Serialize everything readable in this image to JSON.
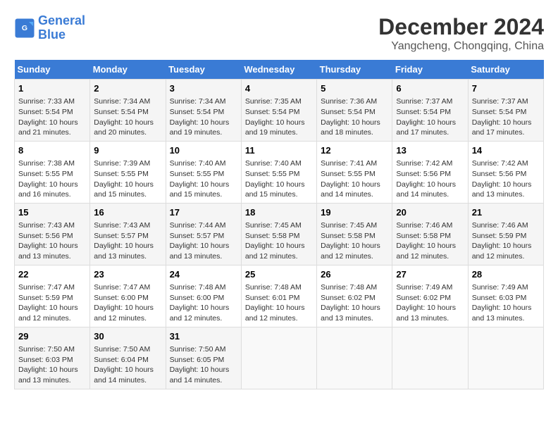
{
  "logo": {
    "line1": "General",
    "line2": "Blue"
  },
  "title": "December 2024",
  "location": "Yangcheng, Chongqing, China",
  "days_header": [
    "Sunday",
    "Monday",
    "Tuesday",
    "Wednesday",
    "Thursday",
    "Friday",
    "Saturday"
  ],
  "weeks": [
    [
      {
        "day": "1",
        "info": "Sunrise: 7:33 AM\nSunset: 5:54 PM\nDaylight: 10 hours\nand 21 minutes."
      },
      {
        "day": "2",
        "info": "Sunrise: 7:34 AM\nSunset: 5:54 PM\nDaylight: 10 hours\nand 20 minutes."
      },
      {
        "day": "3",
        "info": "Sunrise: 7:34 AM\nSunset: 5:54 PM\nDaylight: 10 hours\nand 19 minutes."
      },
      {
        "day": "4",
        "info": "Sunrise: 7:35 AM\nSunset: 5:54 PM\nDaylight: 10 hours\nand 19 minutes."
      },
      {
        "day": "5",
        "info": "Sunrise: 7:36 AM\nSunset: 5:54 PM\nDaylight: 10 hours\nand 18 minutes."
      },
      {
        "day": "6",
        "info": "Sunrise: 7:37 AM\nSunset: 5:54 PM\nDaylight: 10 hours\nand 17 minutes."
      },
      {
        "day": "7",
        "info": "Sunrise: 7:37 AM\nSunset: 5:54 PM\nDaylight: 10 hours\nand 17 minutes."
      }
    ],
    [
      {
        "day": "8",
        "info": "Sunrise: 7:38 AM\nSunset: 5:55 PM\nDaylight: 10 hours\nand 16 minutes."
      },
      {
        "day": "9",
        "info": "Sunrise: 7:39 AM\nSunset: 5:55 PM\nDaylight: 10 hours\nand 15 minutes."
      },
      {
        "day": "10",
        "info": "Sunrise: 7:40 AM\nSunset: 5:55 PM\nDaylight: 10 hours\nand 15 minutes."
      },
      {
        "day": "11",
        "info": "Sunrise: 7:40 AM\nSunset: 5:55 PM\nDaylight: 10 hours\nand 15 minutes."
      },
      {
        "day": "12",
        "info": "Sunrise: 7:41 AM\nSunset: 5:55 PM\nDaylight: 10 hours\nand 14 minutes."
      },
      {
        "day": "13",
        "info": "Sunrise: 7:42 AM\nSunset: 5:56 PM\nDaylight: 10 hours\nand 14 minutes."
      },
      {
        "day": "14",
        "info": "Sunrise: 7:42 AM\nSunset: 5:56 PM\nDaylight: 10 hours\nand 13 minutes."
      }
    ],
    [
      {
        "day": "15",
        "info": "Sunrise: 7:43 AM\nSunset: 5:56 PM\nDaylight: 10 hours\nand 13 minutes."
      },
      {
        "day": "16",
        "info": "Sunrise: 7:43 AM\nSunset: 5:57 PM\nDaylight: 10 hours\nand 13 minutes."
      },
      {
        "day": "17",
        "info": "Sunrise: 7:44 AM\nSunset: 5:57 PM\nDaylight: 10 hours\nand 13 minutes."
      },
      {
        "day": "18",
        "info": "Sunrise: 7:45 AM\nSunset: 5:58 PM\nDaylight: 10 hours\nand 12 minutes."
      },
      {
        "day": "19",
        "info": "Sunrise: 7:45 AM\nSunset: 5:58 PM\nDaylight: 10 hours\nand 12 minutes."
      },
      {
        "day": "20",
        "info": "Sunrise: 7:46 AM\nSunset: 5:58 PM\nDaylight: 10 hours\nand 12 minutes."
      },
      {
        "day": "21",
        "info": "Sunrise: 7:46 AM\nSunset: 5:59 PM\nDaylight: 10 hours\nand 12 minutes."
      }
    ],
    [
      {
        "day": "22",
        "info": "Sunrise: 7:47 AM\nSunset: 5:59 PM\nDaylight: 10 hours\nand 12 minutes."
      },
      {
        "day": "23",
        "info": "Sunrise: 7:47 AM\nSunset: 6:00 PM\nDaylight: 10 hours\nand 12 minutes."
      },
      {
        "day": "24",
        "info": "Sunrise: 7:48 AM\nSunset: 6:00 PM\nDaylight: 10 hours\nand 12 minutes."
      },
      {
        "day": "25",
        "info": "Sunrise: 7:48 AM\nSunset: 6:01 PM\nDaylight: 10 hours\nand 12 minutes."
      },
      {
        "day": "26",
        "info": "Sunrise: 7:48 AM\nSunset: 6:02 PM\nDaylight: 10 hours\nand 13 minutes."
      },
      {
        "day": "27",
        "info": "Sunrise: 7:49 AM\nSunset: 6:02 PM\nDaylight: 10 hours\nand 13 minutes."
      },
      {
        "day": "28",
        "info": "Sunrise: 7:49 AM\nSunset: 6:03 PM\nDaylight: 10 hours\nand 13 minutes."
      }
    ],
    [
      {
        "day": "29",
        "info": "Sunrise: 7:50 AM\nSunset: 6:03 PM\nDaylight: 10 hours\nand 13 minutes."
      },
      {
        "day": "30",
        "info": "Sunrise: 7:50 AM\nSunset: 6:04 PM\nDaylight: 10 hours\nand 14 minutes."
      },
      {
        "day": "31",
        "info": "Sunrise: 7:50 AM\nSunset: 6:05 PM\nDaylight: 10 hours\nand 14 minutes."
      },
      {
        "day": "",
        "info": ""
      },
      {
        "day": "",
        "info": ""
      },
      {
        "day": "",
        "info": ""
      },
      {
        "day": "",
        "info": ""
      }
    ]
  ]
}
